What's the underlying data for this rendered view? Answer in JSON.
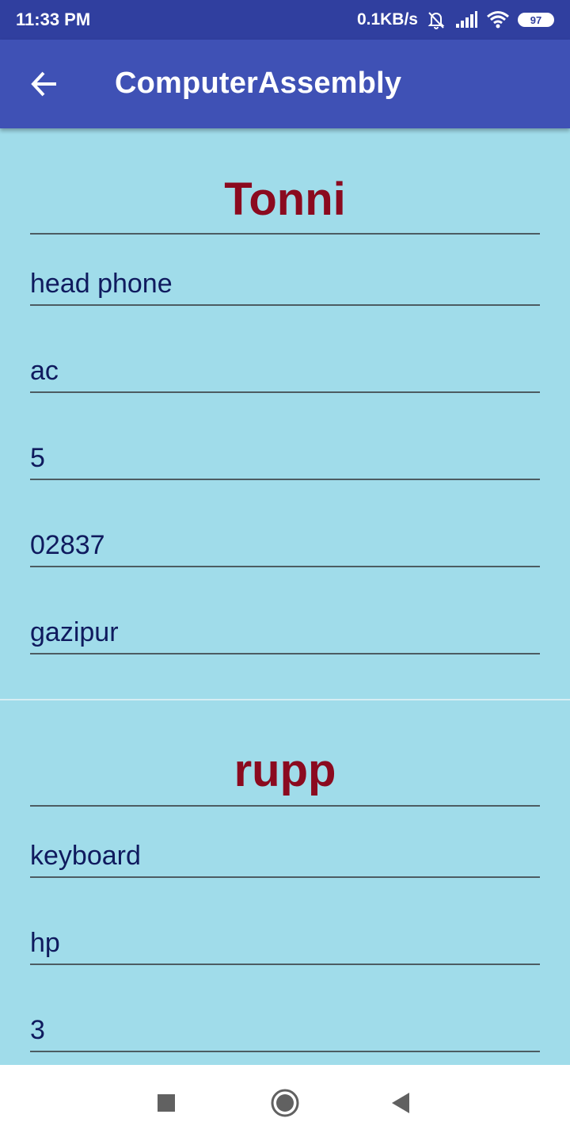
{
  "status_bar": {
    "time": "11:33 PM",
    "net_speed": "0.1KB/s",
    "battery": "97",
    "icons": [
      "mute-bell-icon",
      "signal-icon",
      "wifi-icon",
      "battery-icon"
    ]
  },
  "app_bar": {
    "title": "ComputerAssembly",
    "back_icon": "arrow-back-icon"
  },
  "records": [
    {
      "name": "Tonni",
      "fields": [
        "head phone",
        "ac",
        "5",
        "02837",
        "gazipur"
      ]
    },
    {
      "name": "rupp",
      "fields": [
        "keyboard",
        "hp",
        "3"
      ]
    }
  ],
  "nav_bar": {
    "icons": [
      "recents-square-icon",
      "home-circle-icon",
      "back-triangle-icon"
    ]
  },
  "colors": {
    "status_bar": "#303f9f",
    "app_bar": "#3f51b5",
    "background": "#a0dcea",
    "name_text": "#8b0a1f",
    "field_text": "#0f1a5e"
  }
}
